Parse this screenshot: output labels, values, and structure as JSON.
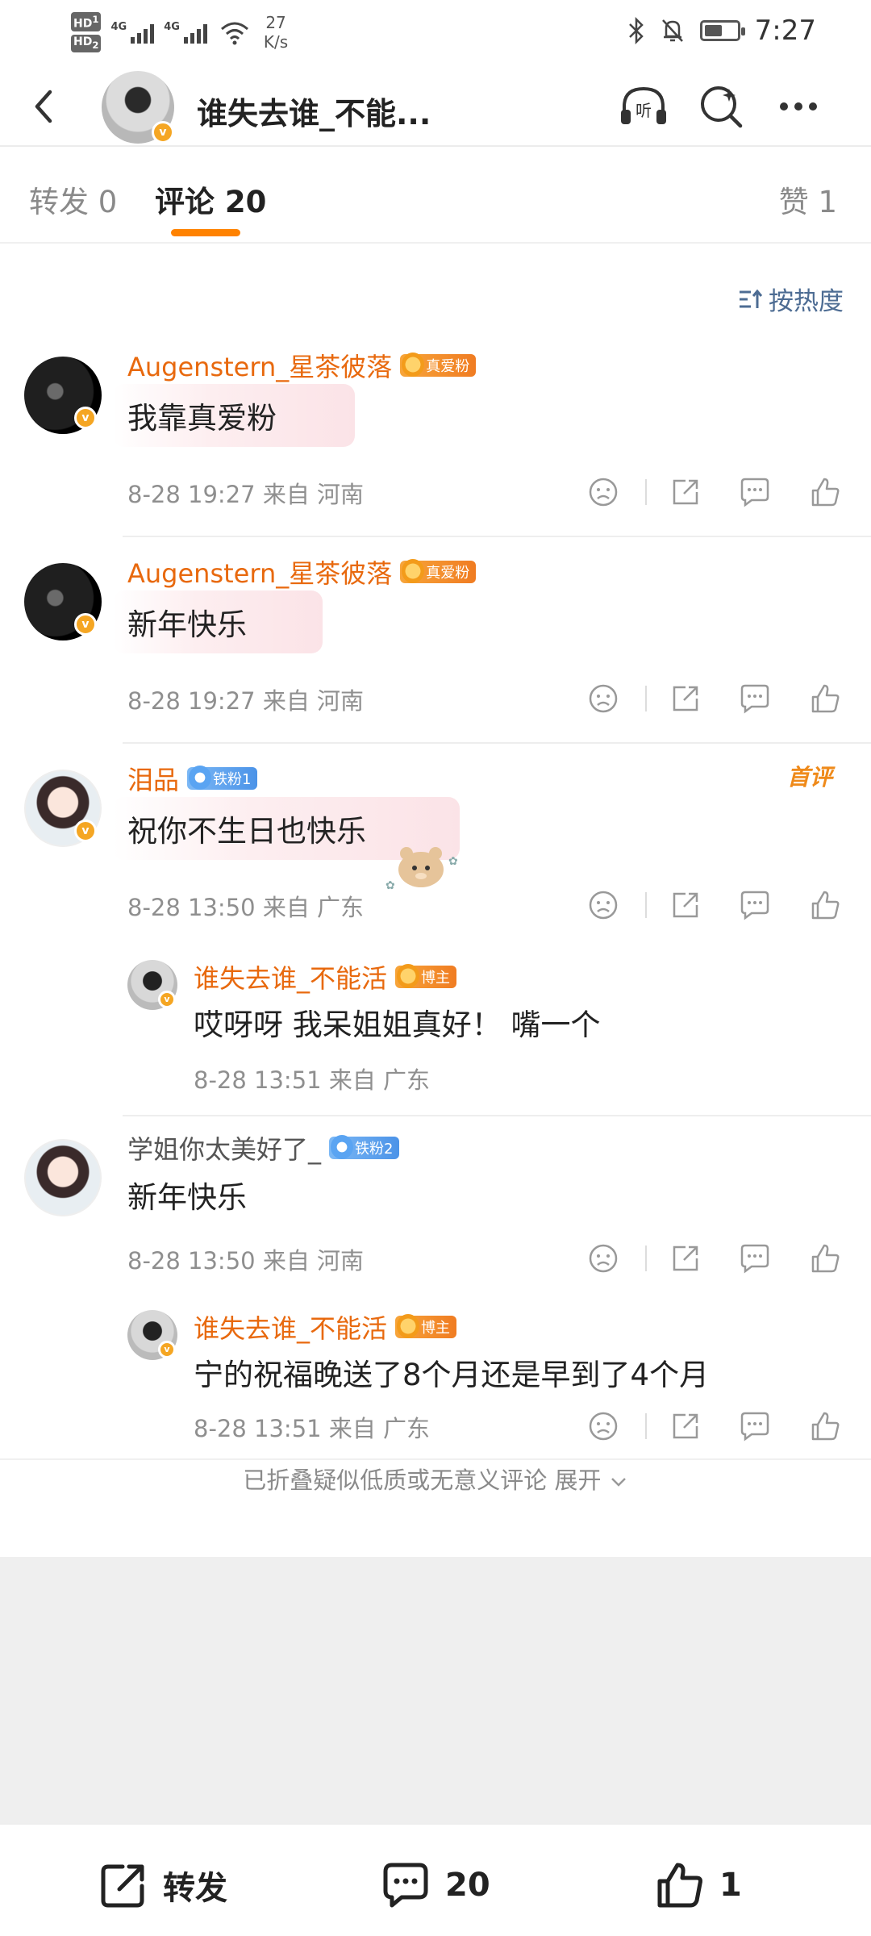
{
  "status_bar": {
    "hd1": "HD",
    "hd1_sub": "1",
    "hd2": "HD",
    "hd2_sub": "2",
    "net1": "4G",
    "net2": "4G",
    "speed_value": "27",
    "speed_unit": "K/s",
    "time": "7:27",
    "battery_level": 0.55,
    "icons": [
      "bluetooth-icon",
      "mute-icon",
      "battery-icon",
      "wifi-icon",
      "signal-icon"
    ]
  },
  "header": {
    "title": "谁失去谁_不能...",
    "verified_mark": "v",
    "icons": [
      "back-icon",
      "listen-icon",
      "search-icon",
      "more-icon"
    ],
    "listen_label": "听"
  },
  "tabs": [
    {
      "label": "转发 0",
      "active": false
    },
    {
      "label": "评论 20",
      "active": true
    },
    {
      "label": "赞 1",
      "active": false
    }
  ],
  "accent_color": "#ff8200",
  "sort_label": "按热度",
  "comments": [
    {
      "name": "Augenstern_星茶彼落",
      "badge": "真爱粉",
      "badge_level": "6",
      "text": "我靠真爱粉",
      "time": "8-28 19:27",
      "location": "来自 河南"
    },
    {
      "name": "Augenstern_星茶彼落",
      "badge": "真爱粉",
      "badge_level": "6",
      "text": "新年快乐",
      "time": "8-28 19:27",
      "location": "来自 河南"
    },
    {
      "name": "泪品",
      "badge": "铁粉1",
      "badge_level": "6",
      "text": "祝你不生日也快乐",
      "time": "8-28 13:50",
      "location": "来自 广东",
      "tag": "首评",
      "reply": {
        "name": "谁失去谁_不能活",
        "badge": "博主",
        "badge_level": "2",
        "text": "哎呀呀 我呆姐姐真好！ 嘴一个",
        "time": "8-28 13:51",
        "location": "来自 广东"
      }
    },
    {
      "name": "学姐你太美好了_",
      "badge": "铁粉2",
      "text": "新年快乐",
      "time": "8-28 13:50",
      "location": "来自 河南",
      "reply": {
        "name": "谁失去谁_不能活",
        "badge": "博主",
        "badge_level": "2",
        "text": "宁的祝福晚送了8个月还是早到了4个月",
        "time": "8-28 13:51",
        "location": "来自 广东"
      }
    }
  ],
  "fold_text": "已折叠疑似低质或无意义评论 展开",
  "bottom_bar": {
    "repost_label": "转发",
    "comment_count": "20",
    "like_count": "1"
  }
}
